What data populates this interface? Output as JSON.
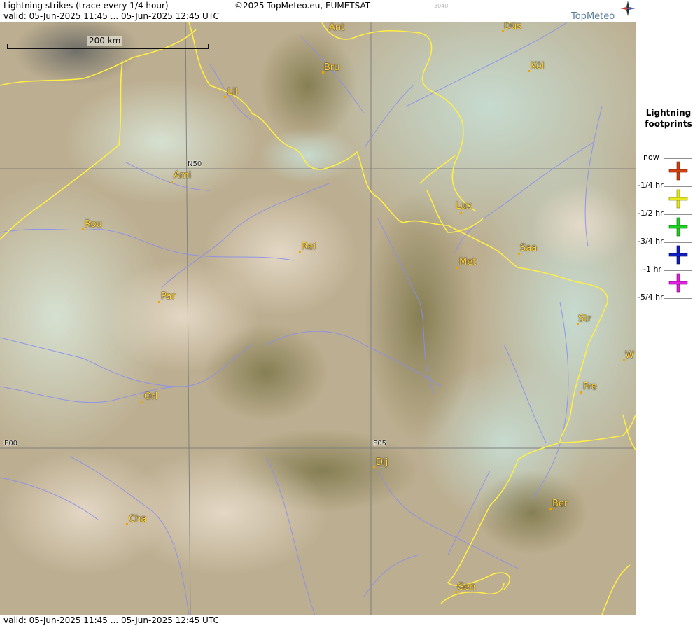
{
  "header": {
    "line1": "Lightning strikes (trace every 1/4 hour)",
    "valid": "valid:  05-Jun-2025 11:45 ... 05-Jun-2025 12:45 UTC",
    "copyright": "©2025 TopMeteo.eu, EUMETSAT",
    "code": "3040",
    "brand": "TopMeteo"
  },
  "scale": {
    "label": "200 km"
  },
  "grid_labels": {
    "n50": "N50",
    "e00": "E00",
    "e05": "E05"
  },
  "cities": [
    {
      "key": "ant",
      "label": "Ant"
    },
    {
      "key": "dus",
      "label": "Düs"
    },
    {
      "key": "bru",
      "label": "Bru"
    },
    {
      "key": "kol",
      "label": "Köl"
    },
    {
      "key": "lil",
      "label": "Lil"
    },
    {
      "key": "ami",
      "label": "Ami"
    },
    {
      "key": "lux",
      "label": "Lux"
    },
    {
      "key": "rou",
      "label": "Rou"
    },
    {
      "key": "rei",
      "label": "Rei"
    },
    {
      "key": "saa",
      "label": "Saa"
    },
    {
      "key": "met",
      "label": "Met"
    },
    {
      "key": "par",
      "label": "Par"
    },
    {
      "key": "str",
      "label": "Str"
    },
    {
      "key": "w",
      "label": "W"
    },
    {
      "key": "fre",
      "label": "Fre"
    },
    {
      "key": "orl",
      "label": "Orl"
    },
    {
      "key": "dij",
      "label": "Dij"
    },
    {
      "key": "ber",
      "label": "Ber"
    },
    {
      "key": "cha",
      "label": "Cha"
    },
    {
      "key": "gen",
      "label": "Gen"
    }
  ],
  "footer": {
    "valid": "valid:  05-Jun-2025 11:45 ... 05-Jun-2025 12:45 UTC"
  },
  "legend": {
    "title1": "Lightning",
    "title2": "footprints",
    "rows": [
      {
        "label": "now",
        "color": ""
      },
      {
        "label": "-1/4 hr",
        "color": "#d04010"
      },
      {
        "label": "-1/2 hr",
        "color": "#e8e820"
      },
      {
        "label": "-3/4 hr",
        "color": "#20d020"
      },
      {
        "label": "-1 hr",
        "color": "#1020c0"
      },
      {
        "label": "-5/4 hr",
        "color": "#e020e0"
      }
    ]
  },
  "colors": {
    "border": "#ffee44",
    "river": "#8a8ef0",
    "grid": "#808080",
    "city": "#ffd23a"
  }
}
